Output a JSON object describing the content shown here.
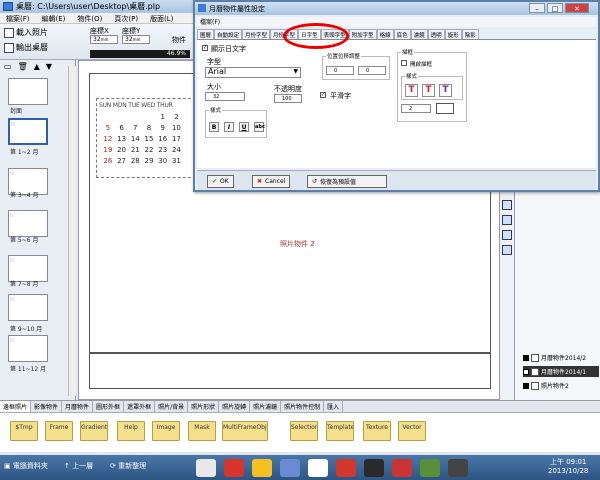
{
  "app": {
    "title": "桌曆: C:\\Users\\user\\Desktop\\桌曆.plp",
    "menu": [
      "檔案(F)",
      "編輯(E)",
      "物件(O)",
      "頁次(P)",
      "版面(L)"
    ]
  },
  "toolbar": {
    "load_photo": "載入照片",
    "export_calendar": "輸出桌曆",
    "coord_x_label": "座標X",
    "coord_y_label": "座標Y",
    "coord_x_value": "32",
    "coord_y_value": "32",
    "unit": "mm",
    "zoom": "46.9%",
    "object_label": "物件"
  },
  "sidebar": {
    "pages": [
      {
        "label": "封面"
      },
      {
        "label": "第 1~2 月",
        "selected": true
      },
      {
        "label": "第 3~4 月"
      },
      {
        "label": "第 5~6 月"
      },
      {
        "label": "第 7~8 月"
      },
      {
        "label": "第 9~10 月"
      },
      {
        "label": "第 11~12 月"
      }
    ]
  },
  "canvas": {
    "calendar_header": "SUN MON TUE WED THUR",
    "calendar_days": [
      [
        "",
        "",
        "",
        "",
        "1",
        "2",
        ""
      ],
      [
        "5",
        "6",
        "7",
        "8",
        "9",
        "10",
        ""
      ],
      [
        "12",
        "13",
        "14",
        "15",
        "16",
        "17",
        ""
      ],
      [
        "19",
        "20",
        "21",
        "22",
        "23",
        "24",
        ""
      ],
      [
        "26",
        "27",
        "28",
        "29",
        "30",
        "31",
        ""
      ]
    ],
    "photo_object_label": "照片物件 2"
  },
  "layers": {
    "items": [
      {
        "label": "月曆物件2014/2"
      },
      {
        "label": "月曆物件2014/1",
        "selected": true
      },
      {
        "label": "照片物件2"
      }
    ]
  },
  "bottom": {
    "tabs": [
      "邊框照片",
      "影像物件",
      "月曆物件",
      "圖形外框",
      "遮罩外框",
      "照片/背景",
      "照片形狀",
      "照片旋轉",
      "照片濾鏡",
      "照片物件控制",
      "匯入"
    ],
    "folders": [
      "$Tmp",
      "Frame",
      "Gradient Template",
      "Help",
      "Image",
      "Mask",
      "MultiFrameObjectTemplat",
      "Selection",
      "Template",
      "Texture",
      "Vector"
    ]
  },
  "taskbar": {
    "item1": "電腦資料夾",
    "item2": "上一層",
    "item3": "重新整理",
    "time": "上午 09:01",
    "date": "2013/10/28"
  },
  "dialog": {
    "title": "月曆物件屬性設定",
    "menu": "檔案(F)",
    "tabs": [
      "圖層",
      "自動設定",
      "月份字型",
      "月份字型",
      "日字型",
      "表頭字型",
      "附加字型",
      "格線",
      "底色",
      "濾鏡",
      "透明",
      "旋形",
      "陰影"
    ],
    "active_tab_index": 4,
    "show_date_text": "顯示日文字",
    "font_label": "字型",
    "font_value": "Arial",
    "size_label": "大小",
    "size_value": "32",
    "opacity_label": "不透明度",
    "opacity_value": "100",
    "style_label": "樣式",
    "style_buttons": [
      "B",
      "I",
      "U",
      "abc"
    ],
    "position_label": "位置位移調整",
    "pos_x": "0",
    "pos_y": "0",
    "smooth_label": "平滑字",
    "border_label": "描框",
    "border_check_label": "開啟描框",
    "border_style_label": "樣式",
    "border_size": "2",
    "ok_label": "OK",
    "cancel_label": "Cancel",
    "restore_label": "恢復為預設值",
    "colors": {
      "red_t": "#cc2233",
      "purple_t": "#6a2a86",
      "highlight": "#e00000"
    }
  }
}
